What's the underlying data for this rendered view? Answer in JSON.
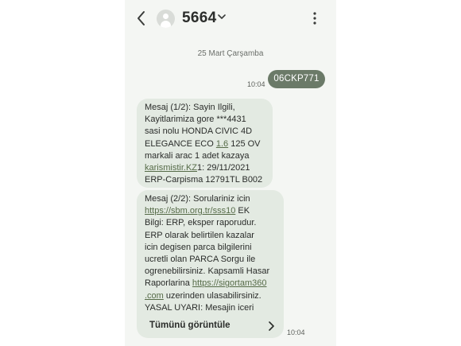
{
  "header": {
    "contact_name": "5664"
  },
  "date_separator": "25 Mart Çarşamba",
  "sent_message": {
    "text": "06CKP771",
    "time": "10:04"
  },
  "message1": {
    "lines": [
      "Mesaj (1/2): Sayin Ilgili,",
      "Kayitlarimiza gore ***4431",
      "sasi nolu HONDA CIVIC 4D",
      "ELEGANCE ECO ",
      "1.6",
      " 125 OV",
      "markali arac 1 adet kazaya",
      "karismistir.KZ",
      "1: 29/11/2021",
      "ERP-Carpisma 12791TL B002"
    ]
  },
  "message2": {
    "lines": [
      "Mesaj (2/2): Sorulariniz icin",
      "https://sbm.org.tr/sss10",
      " EK",
      "Bilgi: ERP, eksper raporudur.",
      "ERP olarak belirtilen kazalar",
      "icin degisen parca bilgilerini",
      "ucretli olan PARCA Sorgu ile",
      "ogrenebilirsiniz. Kapsamli Hasar",
      "Raporlarina ",
      "https://sigortam360",
      ".com",
      " uzerinden ulasabilirsiniz.",
      "YASAL UYARI: Mesajin iceri"
    ],
    "view_all_label": "Tümünü görüntüle",
    "time": "10:04"
  }
}
